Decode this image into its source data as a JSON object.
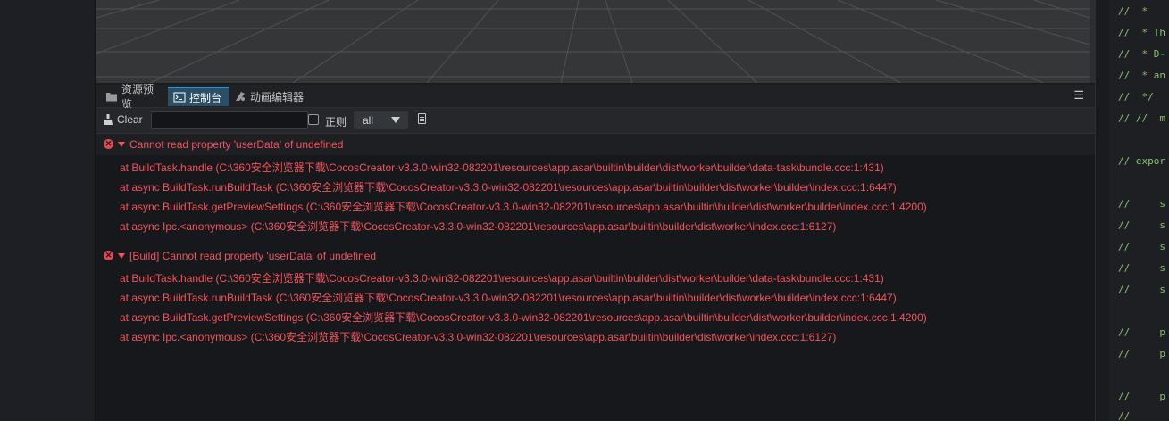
{
  "tabs": [
    {
      "label": "资源预览",
      "icon": "folder-icon"
    },
    {
      "label": "控制台",
      "icon": "terminal-icon",
      "active": true
    },
    {
      "label": "动画编辑器",
      "icon": "animation-icon"
    }
  ],
  "toolbar": {
    "clear_label": "Clear",
    "search_value": "",
    "regex_label": "正则",
    "level_select": "all"
  },
  "console": {
    "entries": [
      {
        "message": "Cannot read property 'userData' of undefined",
        "stack": [
          "at BuildTask.handle (C:\\360安全浏览器下载\\CocosCreator-v3.3.0-win32-082201\\resources\\app.asar\\builtin\\builder\\dist\\worker\\builder\\data-task\\bundle.ccc:1:431)",
          "at async BuildTask.runBuildTask (C:\\360安全浏览器下载\\CocosCreator-v3.3.0-win32-082201\\resources\\app.asar\\builtin\\builder\\dist\\worker\\builder\\index.ccc:1:6447)",
          "at async BuildTask.getPreviewSettings (C:\\360安全浏览器下载\\CocosCreator-v3.3.0-win32-082201\\resources\\app.asar\\builtin\\builder\\dist\\worker\\builder\\index.ccc:1:4200)",
          "at async Ipc.<anonymous> (C:\\360安全浏览器下载\\CocosCreator-v3.3.0-win32-082201\\resources\\app.asar\\builtin\\builder\\dist\\worker\\index.ccc:1:6127)"
        ]
      },
      {
        "message": "[Build] Cannot read property 'userData' of undefined",
        "stack": [
          "at BuildTask.handle (C:\\360安全浏览器下载\\CocosCreator-v3.3.0-win32-082201\\resources\\app.asar\\builtin\\builder\\dist\\worker\\builder\\data-task\\bundle.ccc:1:431)",
          "at async BuildTask.runBuildTask (C:\\360安全浏览器下载\\CocosCreator-v3.3.0-win32-082201\\resources\\app.asar\\builtin\\builder\\dist\\worker\\builder\\index.ccc:1:6447)",
          "at async BuildTask.getPreviewSettings (C:\\360安全浏览器下载\\CocosCreator-v3.3.0-win32-082201\\resources\\app.asar\\builtin\\builder\\dist\\worker\\builder\\index.ccc:1:4200)",
          "at async Ipc.<anonymous> (C:\\360安全浏览器下载\\CocosCreator-v3.3.0-win32-082201\\resources\\app.asar\\builtin\\builder\\dist\\worker\\index.ccc:1:6127)"
        ]
      }
    ]
  },
  "code_lines": [
    "//  *",
    "//  * Th",
    "//  * D-",
    "//  * an",
    "//  */",
    "// //  m",
    "",
    "// expor",
    "",
    "//     s",
    "//     s",
    "//     s",
    "//     s",
    "//     s",
    "",
    "//     p",
    "//     p",
    "",
    "//     p",
    "//"
  ],
  "colors": {
    "error": "#f2545b",
    "accent": "#2a4f66",
    "code_comment": "#88c070"
  }
}
